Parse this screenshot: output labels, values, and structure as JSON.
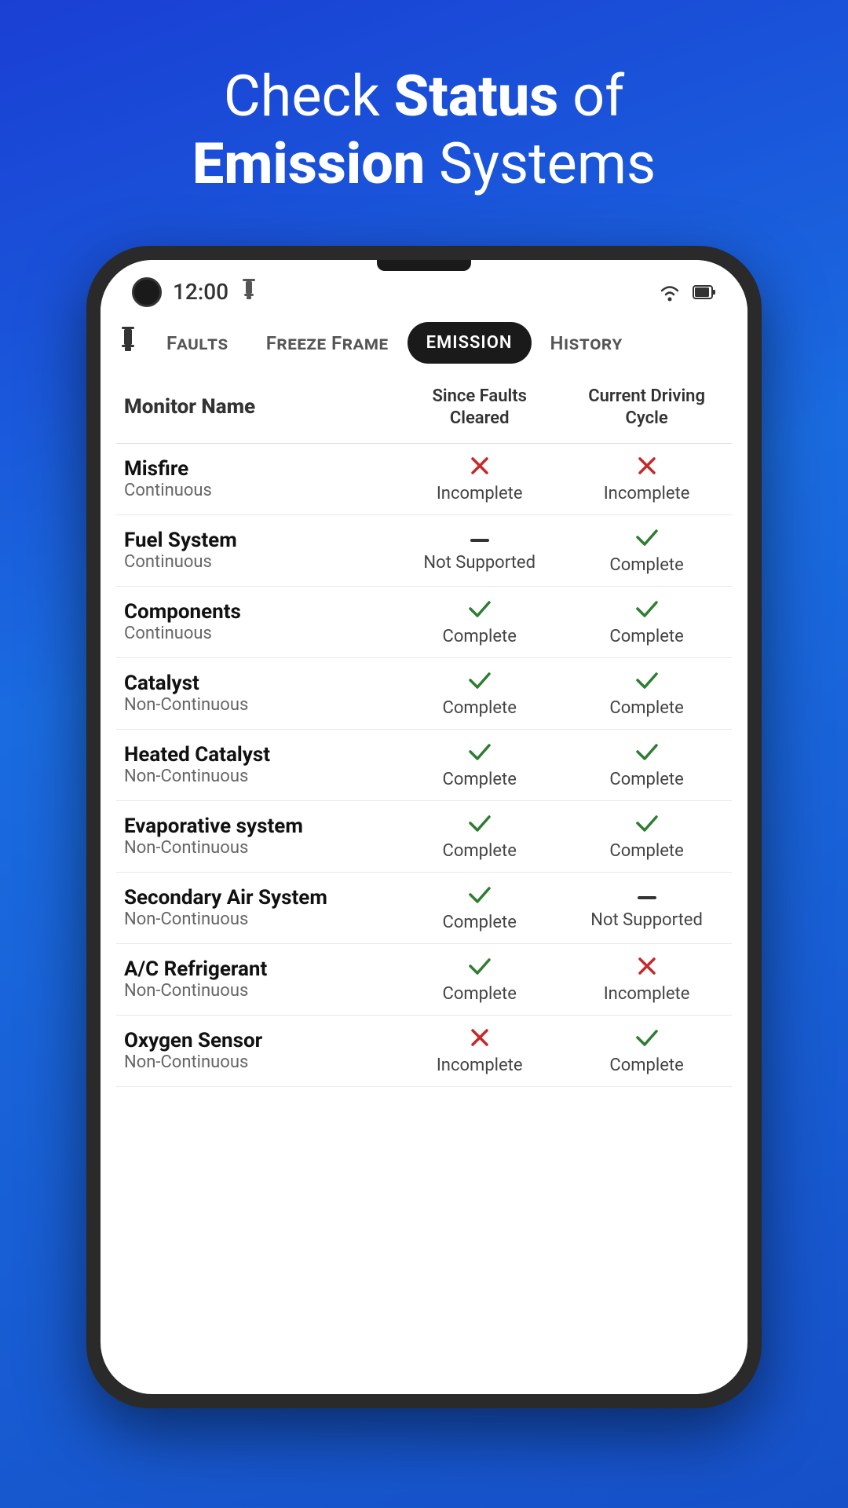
{
  "hero": {
    "line1": "Check ",
    "bold1": "Status",
    "line2": " of",
    "line3_bold": "Emission",
    "line3_rest": " Systems"
  },
  "status_bar": {
    "time": "12:00",
    "obd_icon": "⏱"
  },
  "nav": {
    "tabs": [
      {
        "id": "faults",
        "label": "Faults",
        "active": false
      },
      {
        "id": "freeze-frame",
        "label": "Freeze Frame",
        "active": false
      },
      {
        "id": "emission",
        "label": "Emission",
        "active": true
      },
      {
        "id": "history",
        "label": "History",
        "active": false
      }
    ]
  },
  "table": {
    "headers": {
      "col0": "Monitor Name",
      "col1": "Since Faults Cleared",
      "col2": "Current Driving Cycle"
    },
    "rows": [
      {
        "name": "Misfire",
        "type": "Continuous",
        "since": {
          "icon": "cross",
          "text": "Incomplete"
        },
        "current": {
          "icon": "cross",
          "text": "Incomplete"
        }
      },
      {
        "name": "Fuel System",
        "type": "Continuous",
        "since": {
          "icon": "dash",
          "text": "Not Supported"
        },
        "current": {
          "icon": "check",
          "text": "Complete"
        }
      },
      {
        "name": "Components",
        "type": "Continuous",
        "since": {
          "icon": "check",
          "text": "Complete"
        },
        "current": {
          "icon": "check",
          "text": "Complete"
        }
      },
      {
        "name": "Catalyst",
        "type": "Non-Continuous",
        "since": {
          "icon": "check",
          "text": "Complete"
        },
        "current": {
          "icon": "check",
          "text": "Complete"
        }
      },
      {
        "name": "Heated Catalyst",
        "type": "Non-Continuous",
        "since": {
          "icon": "check",
          "text": "Complete"
        },
        "current": {
          "icon": "check",
          "text": "Complete"
        }
      },
      {
        "name": "Evaporative system",
        "type": "Non-Continuous",
        "since": {
          "icon": "check",
          "text": "Complete"
        },
        "current": {
          "icon": "check",
          "text": "Complete"
        }
      },
      {
        "name": "Secondary Air System",
        "type": "Non-Continuous",
        "since": {
          "icon": "check",
          "text": "Complete"
        },
        "current": {
          "icon": "dash",
          "text": "Not Supported"
        }
      },
      {
        "name": "A/C Refrigerant",
        "type": "Non-Continuous",
        "since": {
          "icon": "check",
          "text": "Complete"
        },
        "current": {
          "icon": "cross",
          "text": "Incomplete"
        }
      },
      {
        "name": "Oxygen Sensor",
        "type": "Non-Continuous",
        "since": {
          "icon": "cross",
          "text": "Incomplete"
        },
        "current": {
          "icon": "check",
          "text": "Complete"
        }
      }
    ]
  },
  "colors": {
    "complete": "#2e7d32",
    "incomplete": "#c62828",
    "not_supported": "#333333",
    "active_tab_bg": "#1a1a1a",
    "active_tab_text": "#ffffff"
  }
}
